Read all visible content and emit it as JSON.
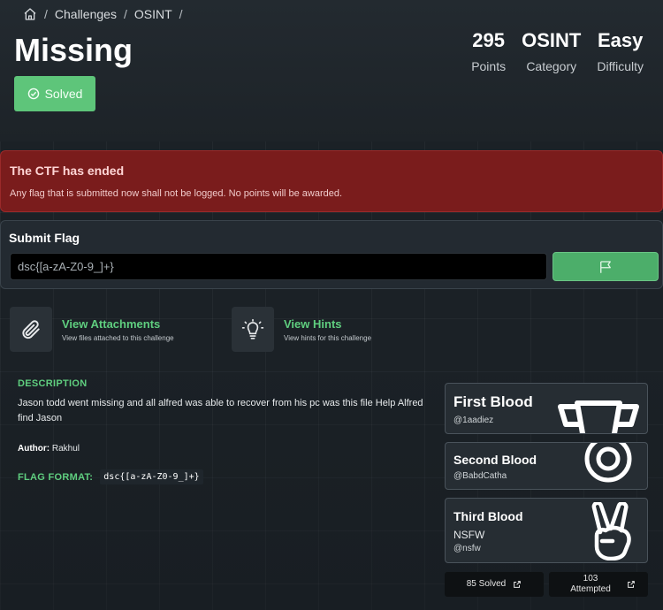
{
  "breadcrumb": {
    "items": [
      "Challenges",
      "OSINT"
    ],
    "sep": "/"
  },
  "challenge": {
    "title": "Missing",
    "solved_label": "Solved",
    "stats": [
      {
        "value": "295",
        "label": "Points"
      },
      {
        "value": "OSINT",
        "label": "Category"
      },
      {
        "value": "Easy",
        "label": "Difficulty"
      }
    ]
  },
  "alert": {
    "title": "The CTF has ended",
    "body": "Any flag that is submitted now shall not be logged. No points will be awarded."
  },
  "submit": {
    "heading": "Submit Flag",
    "placeholder": "dsc{[a-zA-Z0-9_]+}"
  },
  "tiles": [
    {
      "title": "View Attachments",
      "subtitle": "View files attached to this challenge"
    },
    {
      "title": "View Hints",
      "subtitle": "View hints for this challenge"
    }
  ],
  "description": {
    "label": "DESCRIPTION",
    "text": "Jason todd went missing and all alfred was able to recover from his pc was this file Help Alfred find Jason",
    "author_label": "Author:",
    "author": "Rakhul",
    "flag_format_label": "FLAG FORMAT:",
    "flag_format": "dsc{[a-zA-Z0-9_]+}"
  },
  "bloods": [
    {
      "title": "First Blood",
      "user": "@1aadiez"
    },
    {
      "title": "Second Blood",
      "user": "@BabdCatha"
    },
    {
      "title": "Third Blood",
      "team": "NSFW",
      "user": "@nsfw"
    }
  ],
  "footer": {
    "solved": "85 Solved",
    "attempted_count": "103",
    "attempted_label": "Attempted"
  },
  "colors": {
    "accent": "#5fce7f",
    "alert": "#7a1c1c",
    "badge": "#5ec57a"
  }
}
